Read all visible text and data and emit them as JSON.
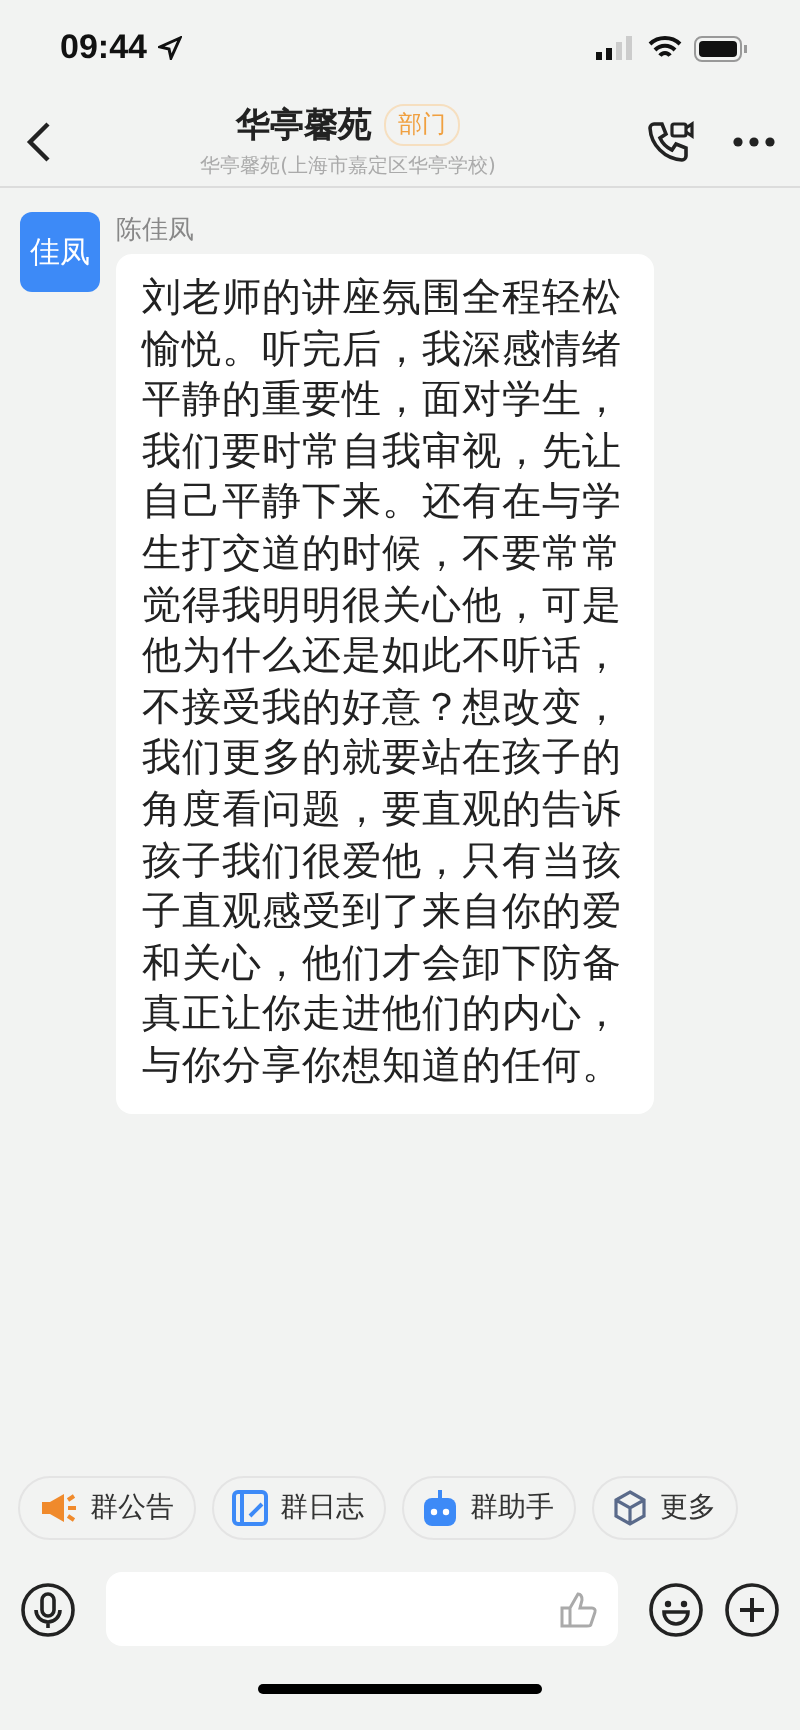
{
  "status_bar": {
    "time": "09:44"
  },
  "header": {
    "title": "华亭馨苑",
    "badge": "部门",
    "subtitle": "华亭馨苑(上海市嘉定区华亭学校)"
  },
  "messages": [
    {
      "avatar": "佳凤",
      "sender": "陈佳凤",
      "text": "刘老师的讲座氛围全程轻松愉悦。听完后，我深感情绪平静的重要性，面对学生，我们要时常自我审视，先让自己平静下来。还有在与学生打交道的时候，不要常常觉得我明明很关心他，可是他为什么还是如此不听话，不接受我的好意？想改变，我们更多的就要站在孩子的角度看问题，要直观的告诉孩子我们很爱他，只有当孩子直观感受到了来自你的爱和关心，他们才会卸下防备真正让你走进他们的内心，与你分享你想知道的任何。"
    }
  ],
  "quick_actions": [
    {
      "kind": "announcement",
      "label": "群公告"
    },
    {
      "kind": "log",
      "label": "群日志"
    },
    {
      "kind": "assistant",
      "label": "群助手"
    },
    {
      "kind": "more",
      "label": "更多"
    }
  ]
}
